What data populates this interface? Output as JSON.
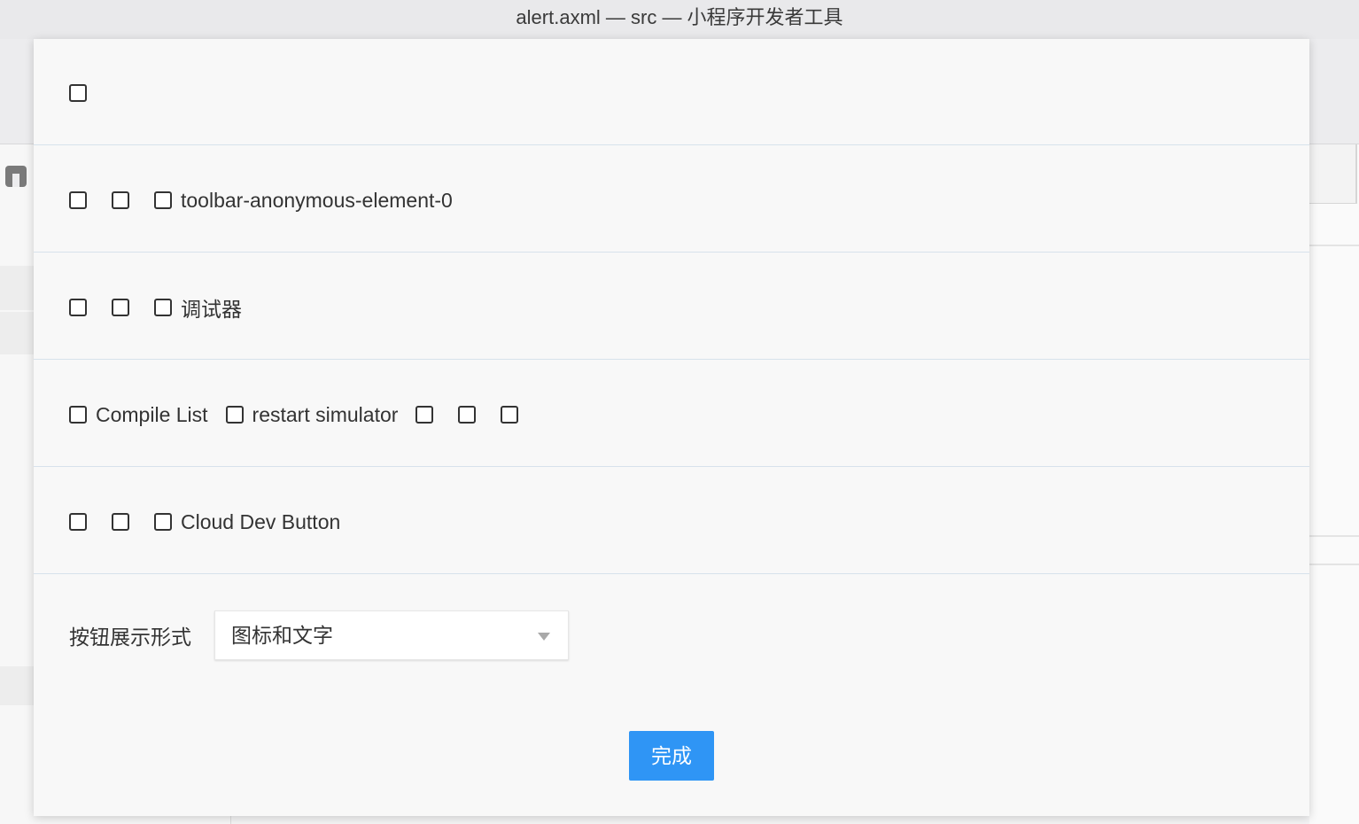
{
  "window": {
    "title": "alert.axml — src — 小程序开发者工具"
  },
  "toolbar_rows": [
    {
      "items": [
        {
          "label": "",
          "checked": false
        }
      ]
    },
    {
      "items": [
        {
          "label": "",
          "checked": false
        },
        {
          "label": "",
          "checked": false
        },
        {
          "label": "toolbar-anonymous-element-0",
          "checked": false
        }
      ]
    },
    {
      "items": [
        {
          "label": "",
          "checked": false
        },
        {
          "label": "",
          "checked": false
        },
        {
          "label": "调试器",
          "checked": false
        }
      ]
    },
    {
      "items": [
        {
          "label": "Compile List",
          "checked": false
        },
        {
          "label": "restart simulator",
          "checked": false
        },
        {
          "label": "",
          "checked": false
        },
        {
          "label": "",
          "checked": false
        },
        {
          "label": "",
          "checked": false
        }
      ]
    },
    {
      "items": [
        {
          "label": "",
          "checked": false
        },
        {
          "label": "",
          "checked": false
        },
        {
          "label": "Cloud Dev Button",
          "checked": false
        }
      ]
    }
  ],
  "display_mode": {
    "label": "按钮展示形式",
    "selected": "图标和文字"
  },
  "done_button": {
    "label": "完成"
  },
  "colors": {
    "accent": "#2f95f5",
    "row_divider": "#d7e2ec",
    "modal_bg": "#f8f8f8"
  }
}
